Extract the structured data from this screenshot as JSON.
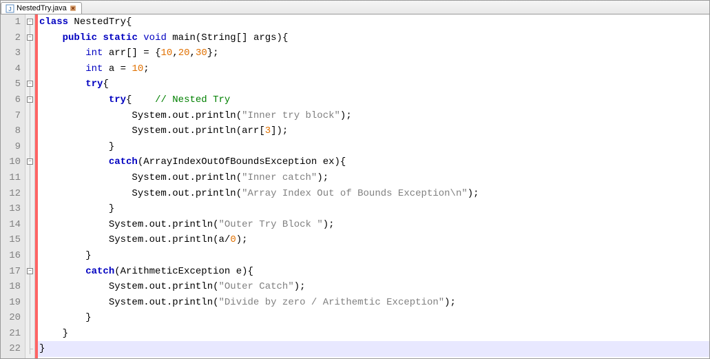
{
  "tab": {
    "filename": "NestedTry.java",
    "icon": "java-file-icon",
    "close_tooltip": "Close"
  },
  "line_count": 22,
  "code": {
    "lines": [
      [
        {
          "t": "kw",
          "v": "class"
        },
        {
          "t": "sp",
          "v": " "
        },
        {
          "t": "ident",
          "v": "NestedTry"
        },
        {
          "t": "op",
          "v": "{"
        }
      ],
      [
        {
          "t": "sp",
          "v": "    "
        },
        {
          "t": "kw",
          "v": "public"
        },
        {
          "t": "sp",
          "v": " "
        },
        {
          "t": "kw",
          "v": "static"
        },
        {
          "t": "sp",
          "v": " "
        },
        {
          "t": "type",
          "v": "void"
        },
        {
          "t": "sp",
          "v": " "
        },
        {
          "t": "ident",
          "v": "main"
        },
        {
          "t": "op",
          "v": "("
        },
        {
          "t": "ident",
          "v": "String"
        },
        {
          "t": "op",
          "v": "[]"
        },
        {
          "t": "sp",
          "v": " "
        },
        {
          "t": "ident",
          "v": "args"
        },
        {
          "t": "op",
          "v": ")"
        },
        {
          "t": "op",
          "v": "{"
        }
      ],
      [
        {
          "t": "sp",
          "v": "        "
        },
        {
          "t": "type",
          "v": "int"
        },
        {
          "t": "sp",
          "v": " "
        },
        {
          "t": "ident",
          "v": "arr"
        },
        {
          "t": "op",
          "v": "[]"
        },
        {
          "t": "sp",
          "v": " "
        },
        {
          "t": "op",
          "v": "="
        },
        {
          "t": "sp",
          "v": " "
        },
        {
          "t": "op",
          "v": "{"
        },
        {
          "t": "num",
          "v": "10"
        },
        {
          "t": "op",
          "v": ","
        },
        {
          "t": "num",
          "v": "20"
        },
        {
          "t": "op",
          "v": ","
        },
        {
          "t": "num",
          "v": "30"
        },
        {
          "t": "op",
          "v": "};"
        }
      ],
      [
        {
          "t": "sp",
          "v": "        "
        },
        {
          "t": "type",
          "v": "int"
        },
        {
          "t": "sp",
          "v": " "
        },
        {
          "t": "ident",
          "v": "a"
        },
        {
          "t": "sp",
          "v": " "
        },
        {
          "t": "op",
          "v": "="
        },
        {
          "t": "sp",
          "v": " "
        },
        {
          "t": "num",
          "v": "10"
        },
        {
          "t": "op",
          "v": ";"
        }
      ],
      [
        {
          "t": "sp",
          "v": "        "
        },
        {
          "t": "kw",
          "v": "try"
        },
        {
          "t": "op",
          "v": "{"
        }
      ],
      [
        {
          "t": "sp",
          "v": "            "
        },
        {
          "t": "kw",
          "v": "try"
        },
        {
          "t": "op",
          "v": "{"
        },
        {
          "t": "sp",
          "v": "    "
        },
        {
          "t": "cmt",
          "v": "// Nested Try"
        }
      ],
      [
        {
          "t": "sp",
          "v": "                "
        },
        {
          "t": "ident",
          "v": "System"
        },
        {
          "t": "op",
          "v": "."
        },
        {
          "t": "ident",
          "v": "out"
        },
        {
          "t": "op",
          "v": "."
        },
        {
          "t": "ident",
          "v": "println"
        },
        {
          "t": "op",
          "v": "("
        },
        {
          "t": "str",
          "v": "\"Inner try block\""
        },
        {
          "t": "op",
          "v": ");"
        }
      ],
      [
        {
          "t": "sp",
          "v": "                "
        },
        {
          "t": "ident",
          "v": "System"
        },
        {
          "t": "op",
          "v": "."
        },
        {
          "t": "ident",
          "v": "out"
        },
        {
          "t": "op",
          "v": "."
        },
        {
          "t": "ident",
          "v": "println"
        },
        {
          "t": "op",
          "v": "("
        },
        {
          "t": "ident",
          "v": "arr"
        },
        {
          "t": "op",
          "v": "["
        },
        {
          "t": "num",
          "v": "3"
        },
        {
          "t": "op",
          "v": "]);"
        }
      ],
      [
        {
          "t": "sp",
          "v": "            "
        },
        {
          "t": "op",
          "v": "}"
        }
      ],
      [
        {
          "t": "sp",
          "v": "            "
        },
        {
          "t": "kw",
          "v": "catch"
        },
        {
          "t": "op",
          "v": "("
        },
        {
          "t": "ident",
          "v": "ArrayIndexOutOfBoundsException"
        },
        {
          "t": "sp",
          "v": " "
        },
        {
          "t": "ident",
          "v": "ex"
        },
        {
          "t": "op",
          "v": ")"
        },
        {
          "t": "op",
          "v": "{"
        }
      ],
      [
        {
          "t": "sp",
          "v": "                "
        },
        {
          "t": "ident",
          "v": "System"
        },
        {
          "t": "op",
          "v": "."
        },
        {
          "t": "ident",
          "v": "out"
        },
        {
          "t": "op",
          "v": "."
        },
        {
          "t": "ident",
          "v": "println"
        },
        {
          "t": "op",
          "v": "("
        },
        {
          "t": "str",
          "v": "\"Inner catch\""
        },
        {
          "t": "op",
          "v": ");"
        }
      ],
      [
        {
          "t": "sp",
          "v": "                "
        },
        {
          "t": "ident",
          "v": "System"
        },
        {
          "t": "op",
          "v": "."
        },
        {
          "t": "ident",
          "v": "out"
        },
        {
          "t": "op",
          "v": "."
        },
        {
          "t": "ident",
          "v": "println"
        },
        {
          "t": "op",
          "v": "("
        },
        {
          "t": "str",
          "v": "\"Array Index Out of Bounds Exception\\n\""
        },
        {
          "t": "op",
          "v": ");"
        }
      ],
      [
        {
          "t": "sp",
          "v": "            "
        },
        {
          "t": "op",
          "v": "}"
        }
      ],
      [
        {
          "t": "sp",
          "v": "            "
        },
        {
          "t": "ident",
          "v": "System"
        },
        {
          "t": "op",
          "v": "."
        },
        {
          "t": "ident",
          "v": "out"
        },
        {
          "t": "op",
          "v": "."
        },
        {
          "t": "ident",
          "v": "println"
        },
        {
          "t": "op",
          "v": "("
        },
        {
          "t": "str",
          "v": "\"Outer Try Block \""
        },
        {
          "t": "op",
          "v": ");"
        }
      ],
      [
        {
          "t": "sp",
          "v": "            "
        },
        {
          "t": "ident",
          "v": "System"
        },
        {
          "t": "op",
          "v": "."
        },
        {
          "t": "ident",
          "v": "out"
        },
        {
          "t": "op",
          "v": "."
        },
        {
          "t": "ident",
          "v": "println"
        },
        {
          "t": "op",
          "v": "("
        },
        {
          "t": "ident",
          "v": "a"
        },
        {
          "t": "op",
          "v": "/"
        },
        {
          "t": "num",
          "v": "0"
        },
        {
          "t": "op",
          "v": ");"
        }
      ],
      [
        {
          "t": "sp",
          "v": "        "
        },
        {
          "t": "op",
          "v": "}"
        }
      ],
      [
        {
          "t": "sp",
          "v": "        "
        },
        {
          "t": "kw",
          "v": "catch"
        },
        {
          "t": "op",
          "v": "("
        },
        {
          "t": "ident",
          "v": "ArithmeticException"
        },
        {
          "t": "sp",
          "v": " "
        },
        {
          "t": "ident",
          "v": "e"
        },
        {
          "t": "op",
          "v": ")"
        },
        {
          "t": "op",
          "v": "{"
        }
      ],
      [
        {
          "t": "sp",
          "v": "            "
        },
        {
          "t": "ident",
          "v": "System"
        },
        {
          "t": "op",
          "v": "."
        },
        {
          "t": "ident",
          "v": "out"
        },
        {
          "t": "op",
          "v": "."
        },
        {
          "t": "ident",
          "v": "println"
        },
        {
          "t": "op",
          "v": "("
        },
        {
          "t": "str",
          "v": "\"Outer Catch\""
        },
        {
          "t": "op",
          "v": ");"
        }
      ],
      [
        {
          "t": "sp",
          "v": "            "
        },
        {
          "t": "ident",
          "v": "System"
        },
        {
          "t": "op",
          "v": "."
        },
        {
          "t": "ident",
          "v": "out"
        },
        {
          "t": "op",
          "v": "."
        },
        {
          "t": "ident",
          "v": "println"
        },
        {
          "t": "op",
          "v": "("
        },
        {
          "t": "str",
          "v": "\"Divide by zero / Arithemtic Exception\""
        },
        {
          "t": "op",
          "v": ");"
        }
      ],
      [
        {
          "t": "sp",
          "v": "        "
        },
        {
          "t": "op",
          "v": "}"
        }
      ],
      [
        {
          "t": "sp",
          "v": "    "
        },
        {
          "t": "op",
          "v": "}"
        }
      ],
      [
        {
          "t": "op",
          "v": "}"
        }
      ]
    ]
  },
  "folds": [
    1,
    2,
    5,
    6,
    10,
    17
  ],
  "lfold": 22,
  "highlight_line": 22
}
